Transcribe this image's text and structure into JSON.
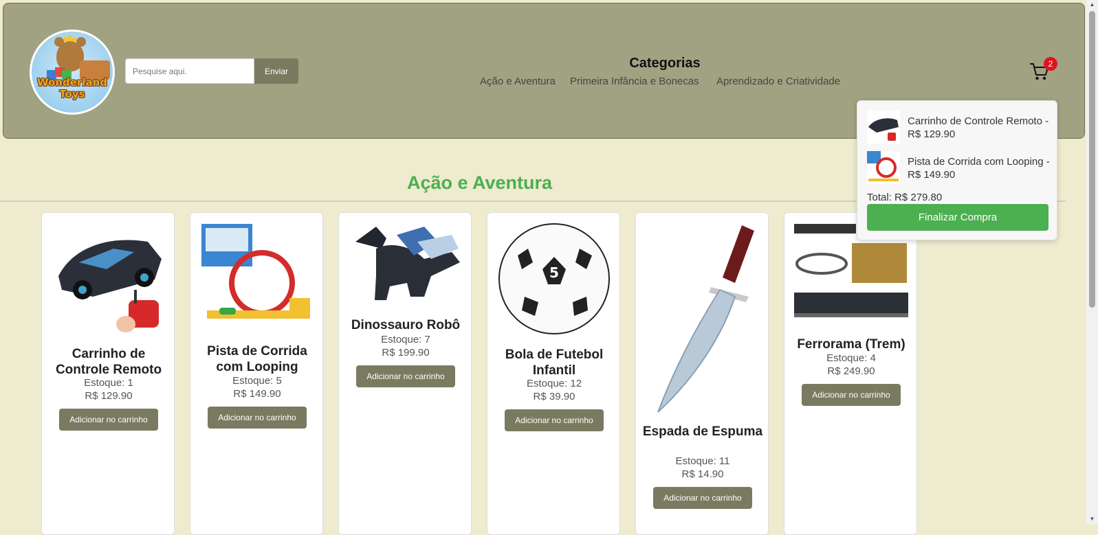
{
  "header": {
    "logo_text": [
      "Wonderland",
      "Toys"
    ],
    "search": {
      "placeholder": "Pesquise aqui.",
      "value": ""
    },
    "search_button": "Enviar",
    "categories_title": "Categorias",
    "categories": [
      "Ação e Aventura",
      "Primeira Infância e Bonecas",
      "Aprendizado e Criatividade"
    ],
    "cart_count": "2",
    "cart_icon": "shopping-cart-icon"
  },
  "cart": {
    "items": [
      {
        "text": "Carrinho de Controle Remoto - R$ 129.90"
      },
      {
        "text": "Pista de Corrida com Looping - R$ 149.90"
      }
    ],
    "total": "Total: R$ 279.80",
    "checkout_label": "Finalizar Compra"
  },
  "section": {
    "title": "Ação e Aventura"
  },
  "products": [
    {
      "name": "Carrinho de Controle Remoto",
      "stock": "Estoque: 1",
      "price": "R$ 129.90",
      "button": "Adicionar no carrinho"
    },
    {
      "name": "Pista de Corrida com Looping",
      "stock": "Estoque: 5",
      "price": "R$ 149.90",
      "button": "Adicionar no carrinho"
    },
    {
      "name": "Dinossauro Robô",
      "stock": "Estoque: 7",
      "price": "R$ 199.90",
      "button": "Adicionar no carrinho"
    },
    {
      "name": "Bola de Futebol Infantil",
      "stock": "Estoque: 12",
      "price": "R$ 39.90",
      "button": "Adicionar no carrinho"
    },
    {
      "name": "Espada de Espuma",
      "stock": "Estoque: 11",
      "price": "R$ 14.90",
      "button": "Adicionar no carrinho"
    },
    {
      "name": "Ferrorama (Trem)",
      "stock": "Estoque: 4",
      "price": "R$ 249.90",
      "button": "Adicionar no carrinho"
    }
  ],
  "colors": {
    "header_bg": "#a1a282",
    "page_bg": "#efebcf",
    "button_bg": "#7a7a61",
    "section_title": "#4caf50",
    "checkout_bg": "#4caf50",
    "badge_bg": "#e0141e"
  }
}
